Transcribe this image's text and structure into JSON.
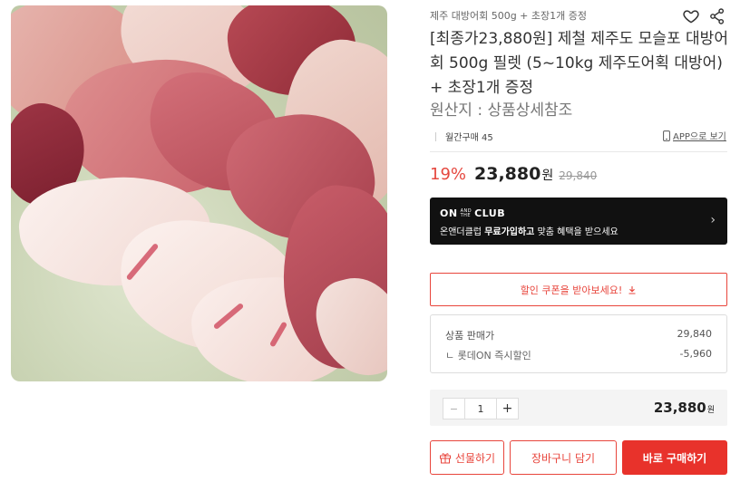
{
  "breadcrumb": "제주 대방어회 500g + 초장1개 증정",
  "title": "[최종가23,880원] 제철 제주도 모슬포 대방어회 500g 필렛 (5~10kg 제주도어획 대방어) + 초장1개 증정",
  "origin": "원산지 : 상품상세참조",
  "monthly_purchase": "월간구매 45",
  "app_link": "APP으로 보기",
  "price": {
    "discount": "19%",
    "sale": "23,880",
    "won": "원",
    "original": "29,840"
  },
  "club": {
    "logo_on": "ON",
    "logo_and": "AND",
    "logo_the": "THE",
    "logo_club": "CLUB",
    "text_prefix": "온앤더클럽 ",
    "text_bold": "무료가입하고",
    "text_suffix": " 맞춤 혜택을 받으세요",
    "arrow": "›"
  },
  "coupon": {
    "label": "할인 쿠폰을 받아보세요!",
    "icon": "download-icon"
  },
  "price_box": {
    "row1_label": "상품 판매가",
    "row1_value": "29,840",
    "row2_label": "ㄴ 롯데ON 즉시할인",
    "row2_value": "-5,960"
  },
  "quantity": {
    "minus": "−",
    "value": "1",
    "plus": "+"
  },
  "total": {
    "amount": "23,880",
    "won": "원"
  },
  "buttons": {
    "gift": "선물하기",
    "cart": "장바구니 담기",
    "buy": "바로 구매하기"
  },
  "colors": {
    "accent": "#e8453c",
    "buy": "#e8322b",
    "club_bg": "#111111"
  }
}
